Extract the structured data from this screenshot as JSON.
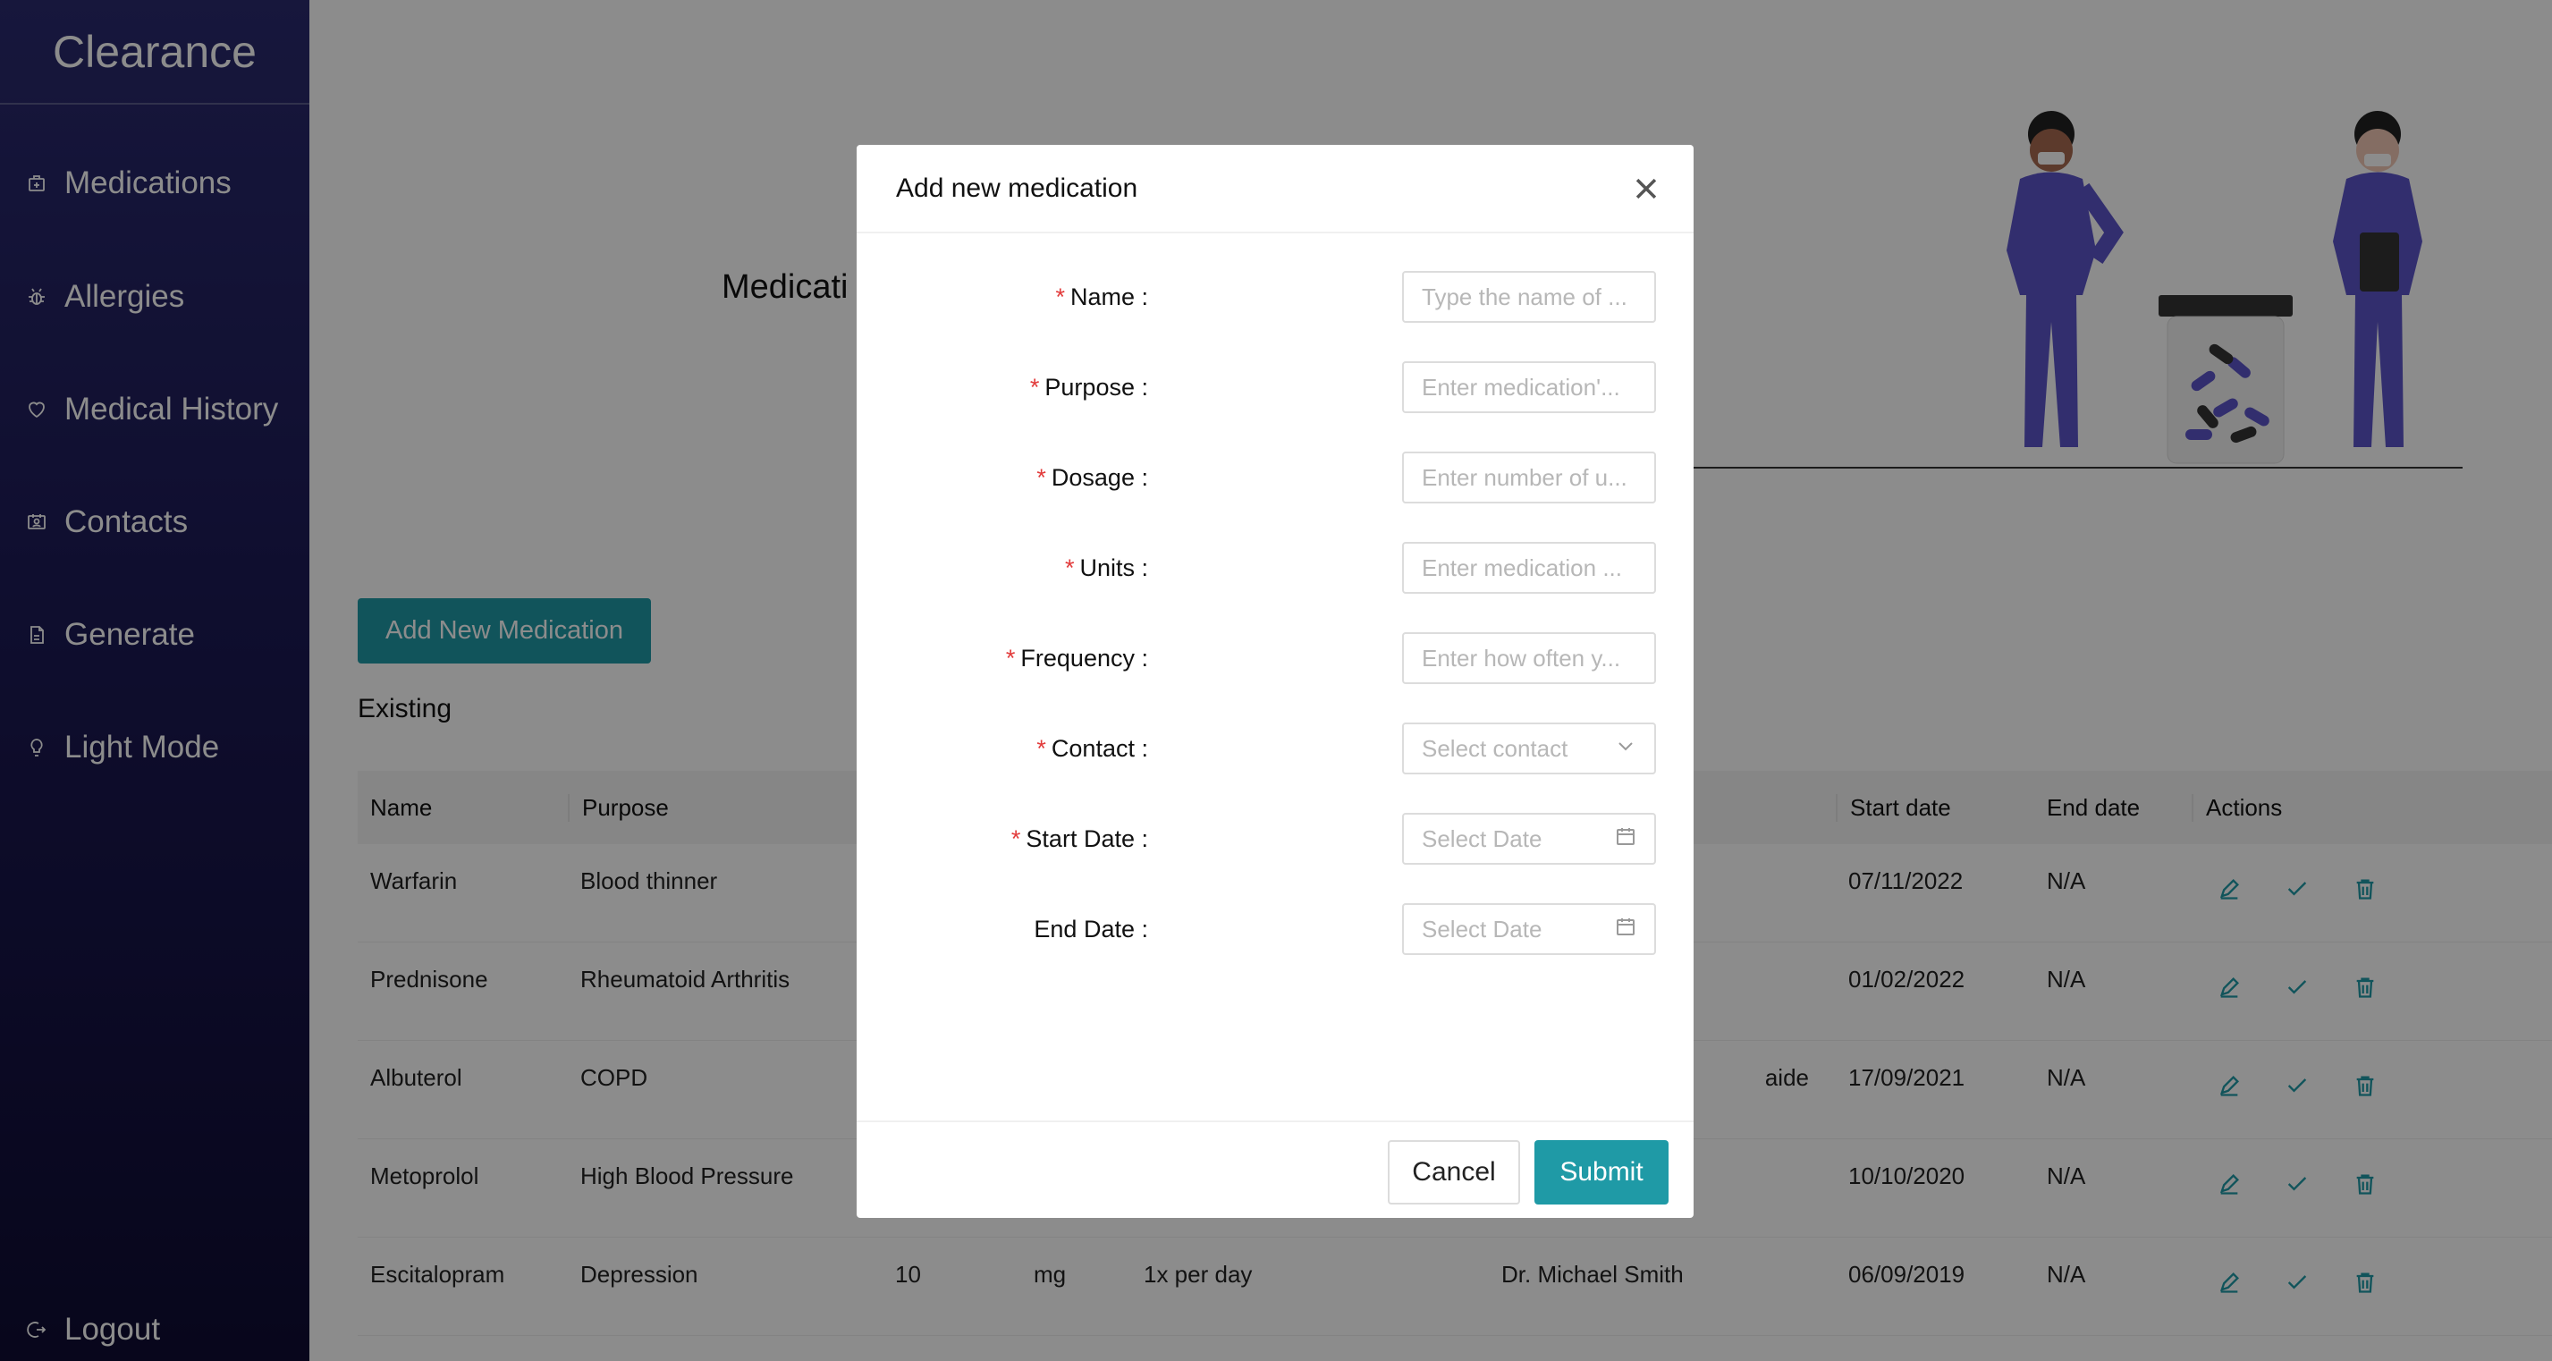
{
  "app": {
    "title": "Clearance"
  },
  "sidebar": {
    "items": [
      {
        "label": "Medications",
        "icon": "medicine-box-icon"
      },
      {
        "label": "Allergies",
        "icon": "bug-icon"
      },
      {
        "label": "Medical History",
        "icon": "heart-icon"
      },
      {
        "label": "Contacts",
        "icon": "contacts-icon"
      },
      {
        "label": "Generate",
        "icon": "file-pdf-icon"
      },
      {
        "label": "Light Mode",
        "icon": "bulb-icon"
      }
    ],
    "logout": {
      "label": "Logout",
      "icon": "logout-icon"
    }
  },
  "main": {
    "hero_title": "Medicati",
    "add_button": "Add New Medication",
    "existing_title": "Existing",
    "table": {
      "headers": [
        "Name",
        "Purpose",
        "",
        "",
        "",
        "",
        "Start date",
        "End date",
        "Actions"
      ],
      "rows": [
        {
          "name": "Warfarin",
          "purpose": "Blood thinner",
          "dosage": "",
          "units": "",
          "frequency": "",
          "contact": "",
          "start": "07/11/2022",
          "end": "N/A"
        },
        {
          "name": "Prednisone",
          "purpose": "Rheumatoid Arthritis",
          "dosage": "",
          "units": "",
          "frequency": "",
          "contact": "",
          "start": "01/02/2022",
          "end": "N/A"
        },
        {
          "name": "Albuterol",
          "purpose": "COPD",
          "dosage": "",
          "units": "",
          "frequency": "",
          "contact": "aide",
          "start": "17/09/2021",
          "end": "N/A"
        },
        {
          "name": "Metoprolol",
          "purpose": "High Blood Pressure",
          "dosage": "",
          "units": "",
          "frequency": "",
          "contact": "",
          "start": "10/10/2020",
          "end": "N/A"
        },
        {
          "name": "Escitalopram",
          "purpose": "Depression",
          "dosage": "10",
          "units": "mg",
          "frequency": "1x per day",
          "contact": "Dr. Michael Smith",
          "start": "06/09/2019",
          "end": "N/A"
        }
      ],
      "action_icons": [
        "edit-icon",
        "check-icon",
        "delete-icon"
      ]
    }
  },
  "modal": {
    "title": "Add new medication",
    "fields": [
      {
        "label": "Name",
        "required": true,
        "placeholder": "Type the name of ...",
        "type": "input"
      },
      {
        "label": "Purpose",
        "required": true,
        "placeholder": "Enter medication'...",
        "type": "input"
      },
      {
        "label": "Dosage",
        "required": true,
        "placeholder": "Enter number of u...",
        "type": "input"
      },
      {
        "label": "Units",
        "required": true,
        "placeholder": "Enter medication ...",
        "type": "input"
      },
      {
        "label": "Frequency",
        "required": true,
        "placeholder": "Enter how often y...",
        "type": "input"
      },
      {
        "label": "Contact",
        "required": true,
        "placeholder": "Select contact",
        "type": "select"
      },
      {
        "label": "Start Date",
        "required": true,
        "placeholder": "Select Date",
        "type": "date"
      },
      {
        "label": "End Date",
        "required": false,
        "placeholder": "Select Date",
        "type": "date"
      }
    ],
    "cancel_label": "Cancel",
    "submit_label": "Submit"
  },
  "colors": {
    "accent": "#1f9aa6",
    "sidebar_top": "#2a2a6e",
    "sidebar_bottom": "#0f0c33",
    "required": "#e23b3b"
  }
}
